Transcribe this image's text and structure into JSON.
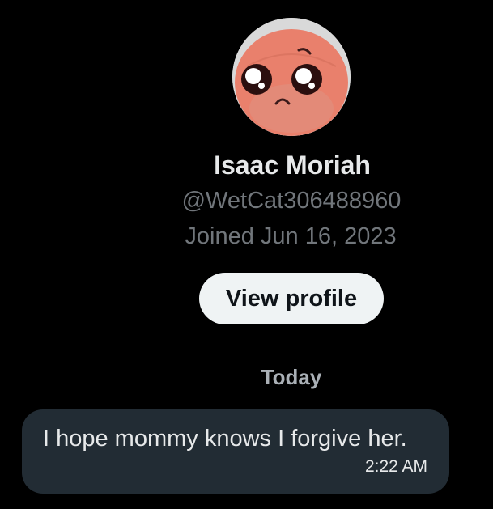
{
  "profile": {
    "avatar_icon": "sad-cartoon-face-avatar",
    "name": "Isaac Moriah",
    "handle": "@WetCat306488960",
    "joined": "Joined Jun 16, 2023",
    "view_profile_label": "View profile"
  },
  "conversation": {
    "date_divider": "Today",
    "messages": [
      {
        "text": "I hope mommy knows I forgive her.",
        "time": "2:22 AM"
      }
    ]
  },
  "colors": {
    "background": "#000000",
    "primary_text": "#e7e9ea",
    "secondary_text": "#71767b",
    "button_bg": "#eff3f4",
    "bubble_bg": "#222c34"
  }
}
